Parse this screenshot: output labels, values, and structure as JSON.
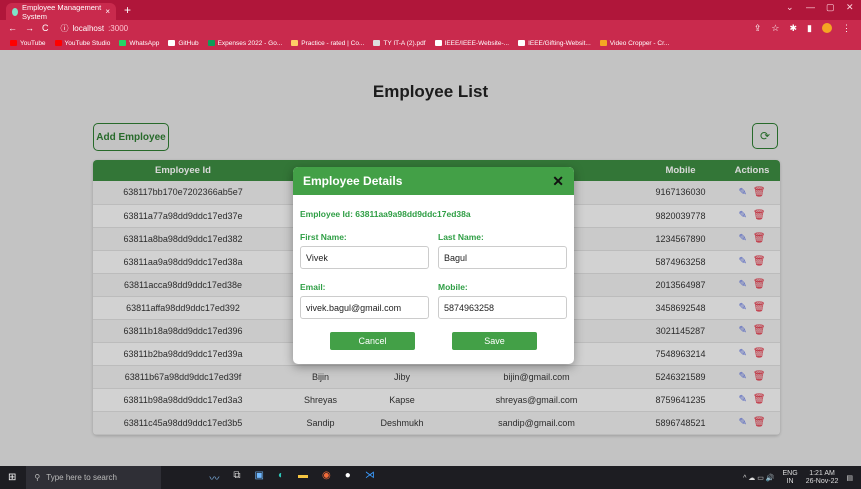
{
  "browser": {
    "tab_title": "Employee Management System",
    "tab_close": "×",
    "new_tab": "+",
    "url_host": "localhost",
    "url_port": ":3000",
    "bookmarks": [
      {
        "label": "YouTube",
        "color": "#ff0000"
      },
      {
        "label": "YouTube Studio",
        "color": "#ff0000"
      },
      {
        "label": "WhatsApp",
        "color": "#25d366"
      },
      {
        "label": "GitHub",
        "color": "#ffffff"
      },
      {
        "label": "Expenses 2022 - Go...",
        "color": "#0f9d58"
      },
      {
        "label": "Practice - rated | Co...",
        "color": "#ffcc66"
      },
      {
        "label": "TY IT-A (2).pdf",
        "color": "#dddddd"
      },
      {
        "label": "IEEE/IEEE-Website-...",
        "color": "#ffffff"
      },
      {
        "label": "IEEE/Gifting-Websit...",
        "color": "#ffffff"
      },
      {
        "label": "Video Cropper - Cr...",
        "color": "#f5a623"
      }
    ]
  },
  "page": {
    "title": "Employee List",
    "add_button": "Add Employee",
    "refresh_icon": "⟳"
  },
  "table": {
    "headers": [
      "Employee Id",
      "",
      "",
      "",
      "Mobile",
      "Actions"
    ],
    "rows": [
      {
        "id": "638117bb170e7202366ab5e7",
        "first": "",
        "last": "",
        "email": "il.com",
        "mobile": "9167136030"
      },
      {
        "id": "63811a77a98dd9ddc17ed37e",
        "first": "",
        "last": "",
        "email": ".com",
        "mobile": "9820039778"
      },
      {
        "id": "63811a8ba98dd9ddc17ed382",
        "first": "",
        "last": "",
        "email": "",
        "mobile": "1234567890"
      },
      {
        "id": "63811aa9a98dd9ddc17ed38a",
        "first": "",
        "last": "",
        "email": "m",
        "mobile": "5874963258"
      },
      {
        "id": "63811acca98dd9ddc17ed38e",
        "first": "",
        "last": "",
        "email": "m",
        "mobile": "2013564987"
      },
      {
        "id": "63811affa98dd9ddc17ed392",
        "first": "",
        "last": "",
        "email": "om",
        "mobile": "3458692548"
      },
      {
        "id": "63811b18a98dd9ddc17ed396",
        "first": "",
        "last": "",
        "email": "m",
        "mobile": "3021145287"
      },
      {
        "id": "63811b2ba98dd9ddc17ed39a",
        "first": "",
        "last": "",
        "email": "",
        "mobile": "7548963214"
      },
      {
        "id": "63811b67a98dd9ddc17ed39f",
        "first": "Bijin",
        "last": "Jiby",
        "email": "bijin@gmail.com",
        "mobile": "5246321589"
      },
      {
        "id": "63811b98a98dd9ddc17ed3a3",
        "first": "Shreyas",
        "last": "Kapse",
        "email": "shreyas@gmail.com",
        "mobile": "8759641235"
      },
      {
        "id": "63811c45a98dd9ddc17ed3b5",
        "first": "Sandip",
        "last": "Deshmukh",
        "email": "sandip@gmail.com",
        "mobile": "5896748521"
      }
    ]
  },
  "modal": {
    "title": "Employee Details",
    "close": "✕",
    "id_label": "Employee Id:",
    "id_value": "63811aa9a98dd9ddc17ed38a",
    "first_name_label": "First Name:",
    "first_name_value": "Vivek",
    "last_name_label": "Last Name:",
    "last_name_value": "Bagul",
    "email_label": "Email:",
    "email_value": "vivek.bagul@gmail.com",
    "mobile_label": "Mobile:",
    "mobile_value": "5874963258",
    "cancel": "Cancel",
    "save": "Save"
  },
  "taskbar": {
    "search_placeholder": "Type here to search",
    "lang": "ENG",
    "region": "IN",
    "time": "1:21 AM",
    "date": "26-Nov-22"
  },
  "colors": {
    "brand_green": "#43a047",
    "header_green": "#3d8b41",
    "chrome": "#c92a4d",
    "edit": "#5a6fe0",
    "delete": "#e0283b"
  }
}
